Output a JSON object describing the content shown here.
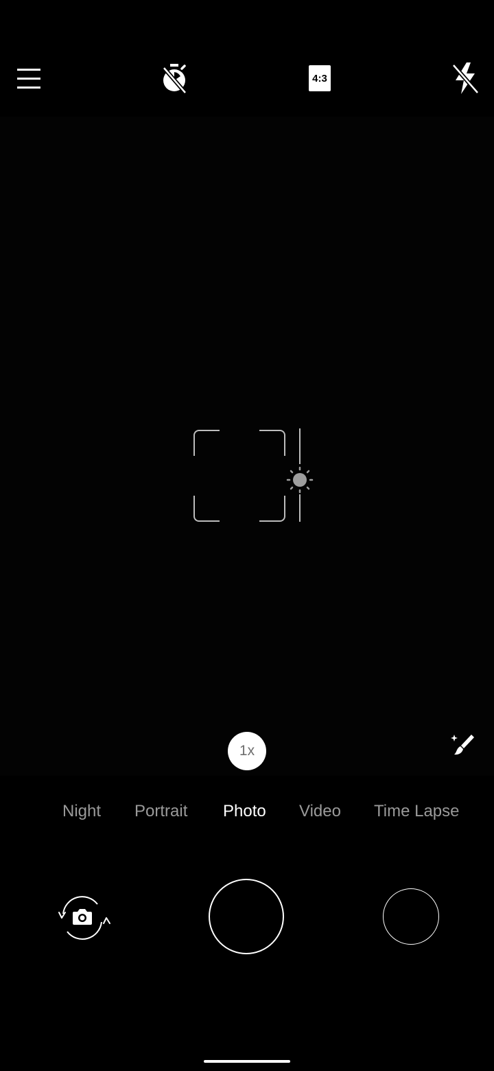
{
  "top_bar": {
    "menu_icon": "hamburger-menu-icon",
    "timer_icon": "timer-off-icon",
    "aspect_ratio": "4:3",
    "flash_icon": "flash-off-icon"
  },
  "viewfinder": {
    "focus_icon": "focus-frame-icon",
    "exposure_icon": "brightness-sun-icon"
  },
  "controls": {
    "zoom_label": "1x",
    "beauty_icon": "magic-brush-icon"
  },
  "modes": [
    {
      "label": "Night",
      "active": false
    },
    {
      "label": "Portrait",
      "active": false
    },
    {
      "label": "Photo",
      "active": true
    },
    {
      "label": "Video",
      "active": false
    },
    {
      "label": "Time Lapse",
      "active": false
    }
  ],
  "bottom": {
    "switch_camera_icon": "switch-camera-icon",
    "shutter_icon": "shutter-button",
    "gallery_icon": "gallery-thumbnail"
  },
  "colors": {
    "background": "#000000",
    "text_active": "#ffffff",
    "text_inactive": "#9a9a9a",
    "focus_frame": "#bdbdbd",
    "zoom_text": "#6e6e6e"
  }
}
